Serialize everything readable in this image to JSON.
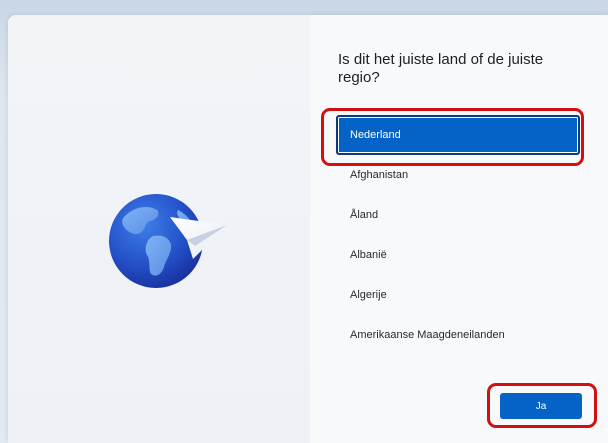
{
  "setup": {
    "question": "Is dit het juiste land of de juiste regio?",
    "countries": [
      {
        "label": "Nederland",
        "selected": true
      },
      {
        "label": "Afghanistan",
        "selected": false
      },
      {
        "label": "Åland",
        "selected": false
      },
      {
        "label": "Albanië",
        "selected": false
      },
      {
        "label": "Algerije",
        "selected": false
      },
      {
        "label": "Amerikaanse Maagdeneilanden",
        "selected": false
      }
    ],
    "confirm_label": "Ja",
    "illustration_icon": "globe-paper-plane-icon"
  },
  "colors": {
    "accent": "#0563c7",
    "highlight": "#d40f0f"
  }
}
